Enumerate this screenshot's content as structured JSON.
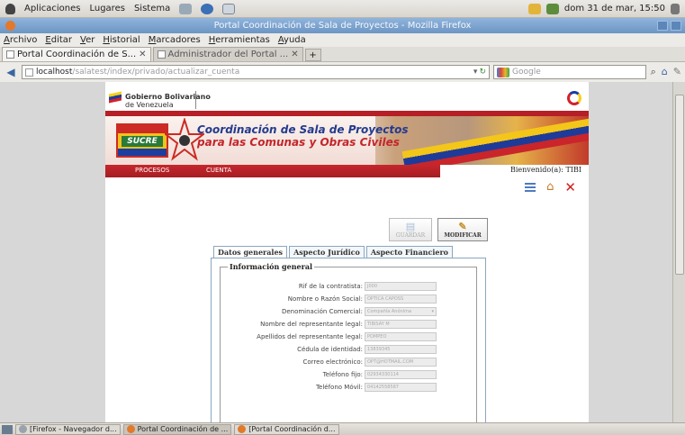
{
  "panel": {
    "menu": [
      "Aplicaciones",
      "Lugares",
      "Sistema"
    ],
    "clock": "dom 31 de mar, 15:50"
  },
  "window": {
    "title": "Portal Coordinación de Sala de Proyectos - Mozilla Firefox"
  },
  "menubar": [
    "Archivo",
    "Editar",
    "Ver",
    "Historial",
    "Marcadores",
    "Herramientas",
    "Ayuda"
  ],
  "tabs": [
    {
      "label": "Portal Coordinación de S..."
    },
    {
      "label": "Administrador del Portal ..."
    }
  ],
  "navbar": {
    "url_host": "localhost",
    "url_path": "/salatest/index/privado/actualizar_cuenta",
    "search_placeholder": "Google"
  },
  "site": {
    "gov_line1": "Gobierno Bolivariano",
    "gov_line2": "de Venezuela",
    "badge_text": "SUCRE",
    "banner_line1": "Coordinación de Sala de Proyectos",
    "banner_line2": "para las Comunas y Obras Civiles",
    "nav": [
      "PROCESOS",
      "CUENTA"
    ],
    "welcome": "Bienvenido(a): TIBI"
  },
  "actions": {
    "save": "GUARDAR",
    "modify": "MODIFICAR"
  },
  "form_tabs": [
    "Datos generales",
    "Aspecto Jurídico",
    "Aspecto Financiero"
  ],
  "form": {
    "legend": "Información general",
    "fields": [
      {
        "label": "Rif de la contratista:",
        "value": "J000"
      },
      {
        "label": "Nombre o Razón Social:",
        "value": "OPTICA CAPOSS"
      },
      {
        "label": "Denominación Comercial:",
        "value": "Compañía Anónima"
      },
      {
        "label": "Nombre del representante legal:",
        "value": "TIBISAY M"
      },
      {
        "label": "Apellidos del representante legal:",
        "value": "POMPEO"
      },
      {
        "label": "Cédula de identidad:",
        "value": "13839345"
      },
      {
        "label": "Correo electrónico:",
        "value": "OPT@HOTMAIL.COM"
      },
      {
        "label": "Teléfono fijo:",
        "value": "02934330114"
      },
      {
        "label": "Teléfono Móvil:",
        "value": "04142558587"
      }
    ]
  },
  "taskbar": [
    {
      "label": "[Firefox - Navegador d..."
    },
    {
      "label": "Portal Coordinación de ..."
    },
    {
      "label": "[Portal Coordinación d..."
    }
  ],
  "colors": {
    "accent_red": "#c5272d",
    "accent_blue": "#233a8e",
    "titlebar": "#7aa0cd"
  }
}
